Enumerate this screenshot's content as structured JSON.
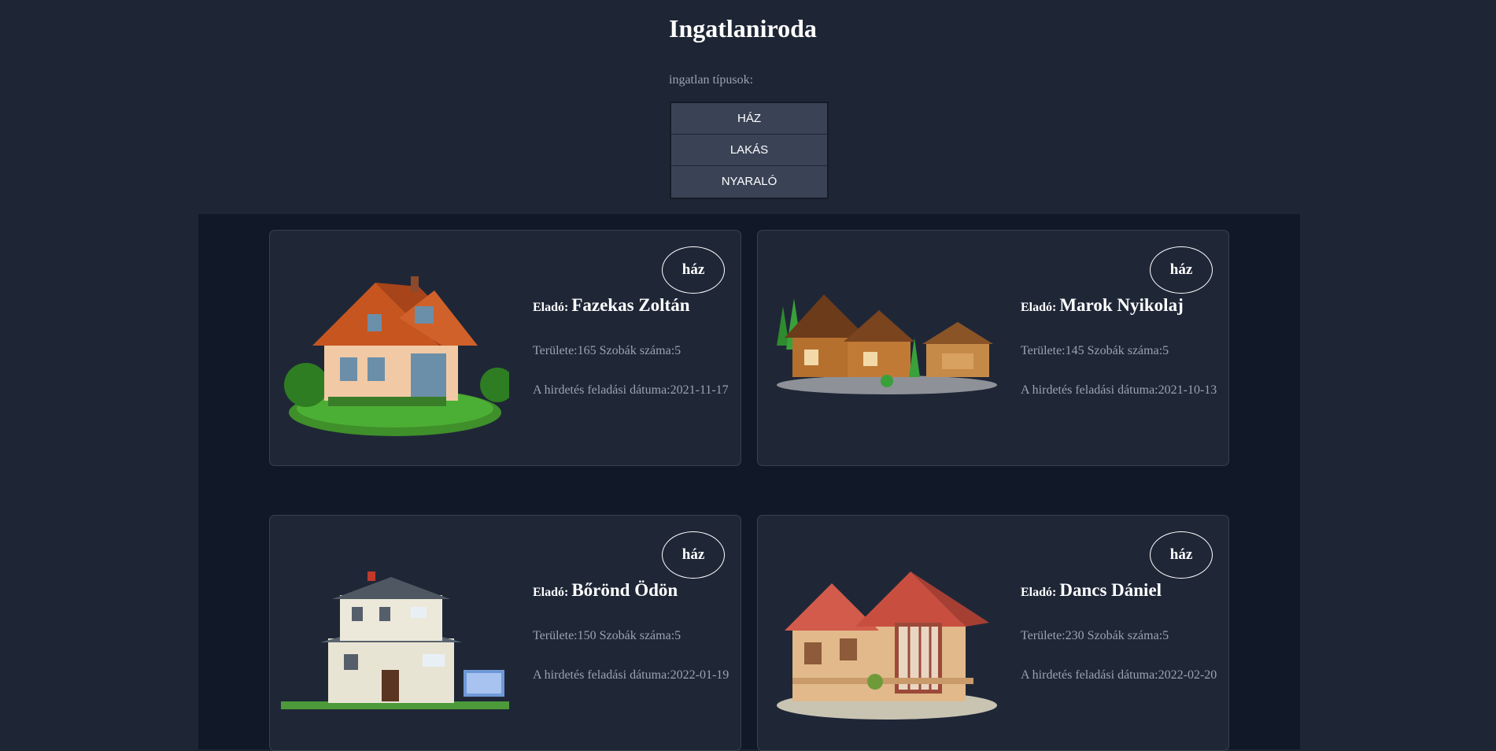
{
  "header": {
    "title": "Ingatlaniroda",
    "types_label": "ingatlan típusok:"
  },
  "type_menu": [
    "HÁZ",
    "LAKÁS",
    "NYARALÓ"
  ],
  "listings": [
    {
      "type": "ház",
      "seller_label": "Eladó:",
      "seller_name": "Fazekas Zoltán",
      "details": "Területe:165 Szobák száma:5",
      "date": "A hirdetés feladási dátuma:2021-11-17",
      "image": "orange-roof-house-icon"
    },
    {
      "type": "ház",
      "seller_label": "Eladó:",
      "seller_name": "Marok Nyikolaj",
      "details": "Területe:145 Szobák száma:5",
      "date": "A hirdetés feladási dátuma:2021-10-13",
      "image": "log-cabin-house-icon"
    },
    {
      "type": "ház",
      "seller_label": "Eladó:",
      "seller_name": "Bőrönd Ödön",
      "details": "Területe:150 Szobák száma:5",
      "date": "A hirdetés feladási dátuma:2022-01-19",
      "image": "white-house-solar-panel-icon"
    },
    {
      "type": "ház",
      "seller_label": "Eladó:",
      "seller_name": "Dancs Dániel",
      "details": "Területe:230 Szobák száma:5",
      "date": "A hirdetés feladási dátuma:2022-02-20",
      "image": "wooden-villa-house-icon"
    }
  ]
}
